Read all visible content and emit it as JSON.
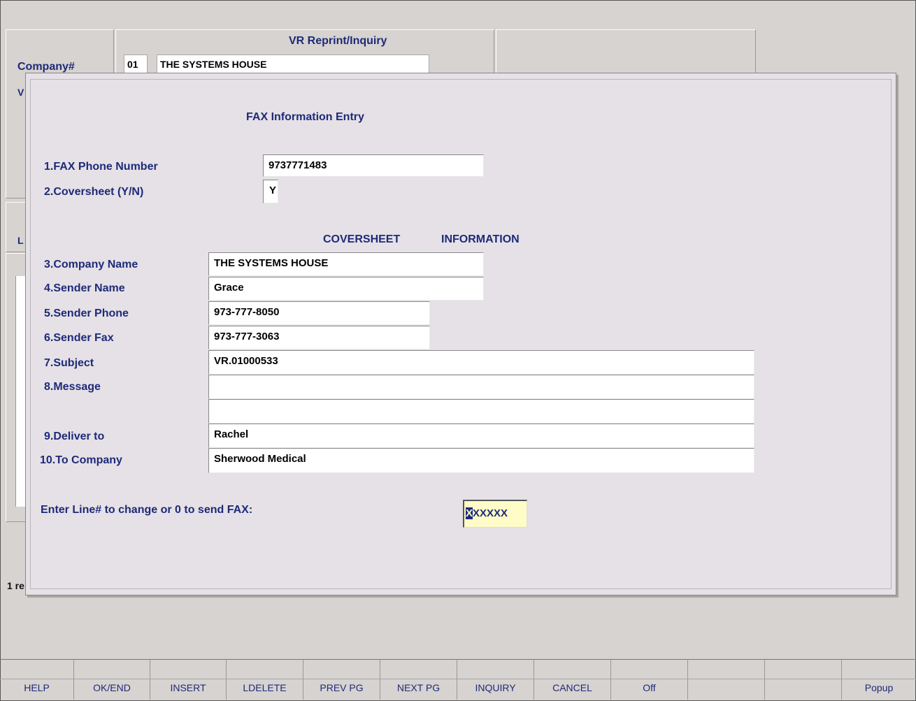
{
  "background": {
    "title": "VR Reprint/Inquiry",
    "company_label": "Company#",
    "company_code": "01",
    "company_name": "THE SYSTEMS HOUSE",
    "stub_v": "V",
    "stub_l": "L",
    "stub_records": "1 re"
  },
  "dialog": {
    "title": "FAX Information Entry",
    "fax_phone": {
      "label": "1.FAX Phone Number",
      "value": "9737771483"
    },
    "coversheet": {
      "label": "2.Coversheet (Y/N)",
      "value": "Y"
    },
    "section_heading_1": "COVERSHEET",
    "section_heading_2": "INFORMATION",
    "company_name": {
      "label": "3.Company Name",
      "value": "THE SYSTEMS HOUSE"
    },
    "sender_name": {
      "label": "4.Sender Name",
      "value": "Grace"
    },
    "sender_phone": {
      "label": "5.Sender Phone",
      "value": "973-777-8050"
    },
    "sender_fax": {
      "label": "6.Sender Fax",
      "value": "973-777-3063"
    },
    "subject": {
      "label": "7.Subject",
      "value": "VR.01000533"
    },
    "message": {
      "label": "8.Message",
      "line1": "",
      "line2": ""
    },
    "deliver_to": {
      "label": "9.Deliver to",
      "value": "Rachel"
    },
    "to_company": {
      "label": "10.To Company",
      "value": "Sherwood Medical"
    },
    "prompt": {
      "label": "Enter Line# to change or 0 to send FAX:",
      "cursor_char": "X",
      "value_rest": "XXXXX"
    }
  },
  "function_keys": [
    "HELP",
    "OK/END",
    "INSERT",
    "LDELETE",
    "PREV PG",
    "NEXT PG",
    "INQUIRY",
    "CANCEL",
    "Off",
    "",
    "",
    "Popup"
  ]
}
